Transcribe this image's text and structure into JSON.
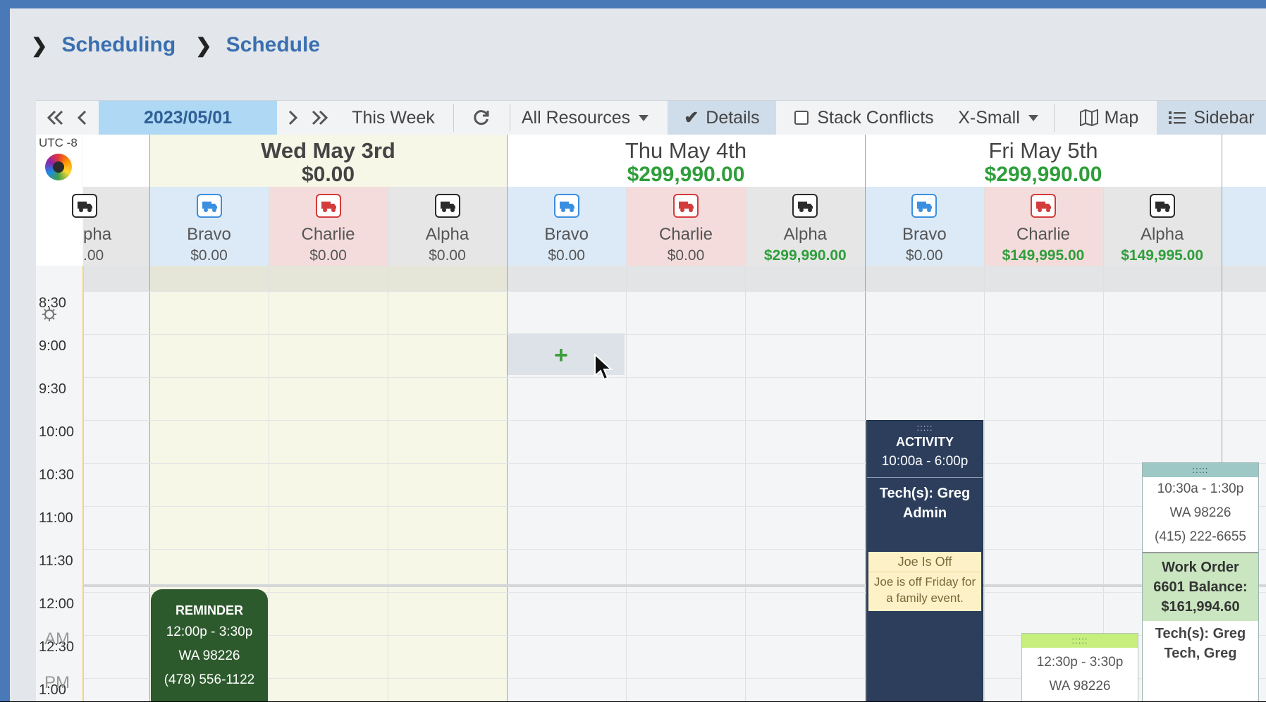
{
  "breadcrumb": [
    "Scheduling",
    "Schedule"
  ],
  "toolbar": {
    "date": "2023/05/01",
    "this_week": "This Week",
    "all_resources": "All Resources",
    "details": "Details",
    "stack_conflicts": "Stack Conflicts",
    "size": "X-Small",
    "map": "Map",
    "sidebar": "Sidebar"
  },
  "timezone": "UTC -8",
  "days": [
    {
      "name": "Wed May 3rd",
      "total": "$0.00",
      "resources": [
        {
          "name": "Bravo",
          "value": "$0.00",
          "color": "#3b8fe0"
        },
        {
          "name": "Charlie",
          "value": "$0.00",
          "color": "#d43b3b"
        },
        {
          "name": "Alpha",
          "value": "$0.00",
          "color": "#2b2b2b"
        }
      ]
    },
    {
      "name": "Thu May 4th",
      "total": "$299,990.00",
      "resources": [
        {
          "name": "Bravo",
          "value": "$0.00",
          "color": "#3b8fe0"
        },
        {
          "name": "Charlie",
          "value": "$0.00",
          "color": "#d43b3b"
        },
        {
          "name": "Alpha",
          "value": "$299,990.00",
          "color": "#2b2b2b"
        }
      ]
    },
    {
      "name": "Fri May 5th",
      "total": "$299,990.00",
      "resources": [
        {
          "name": "Bravo",
          "value": "$0.00",
          "color": "#3b8fe0"
        },
        {
          "name": "Charlie",
          "value": "$149,995.00",
          "color": "#d43b3b"
        },
        {
          "name": "Alpha",
          "value": "$149,995.00",
          "color": "#2b2b2b"
        }
      ]
    }
  ],
  "partial_prev": {
    "name": "pha",
    "value": ".00"
  },
  "times": [
    "8:30",
    "9:00",
    "9:30",
    "10:00",
    "10:30",
    "11:00",
    "11:30",
    "12:00",
    "12:30",
    "1:00"
  ],
  "ampm": {
    "am": "AM",
    "pm": "PM"
  },
  "events": {
    "reminder": {
      "title": "REMINDER",
      "time": "12:00p - 3:30p",
      "zip": "WA 98226",
      "phone": "(478) 556-1122"
    },
    "activity": {
      "title": "ACTIVITY",
      "time": "10:00a - 6:00p",
      "techs": "Tech(s): Greg Admin",
      "note_title": "Joe Is Off",
      "note_text": "Joe is off Friday for a family event."
    },
    "charlie_job": {
      "time": "12:30p - 3:30p",
      "zip": "WA 98226"
    },
    "alpha_job": {
      "time": "10:30a - 1:30p",
      "zip": "WA 98226",
      "phone": "(415) 222-6655",
      "work_order": "Work Order 6601 Balance: $161,994.60",
      "techs": "Tech(s): Greg Tech, Greg"
    }
  },
  "colors": {
    "accent": "#3a6fb0",
    "positive": "#2e9e3a",
    "activity_bg": "#2c3e5c",
    "reminder_bg": "#2d5a2d"
  }
}
